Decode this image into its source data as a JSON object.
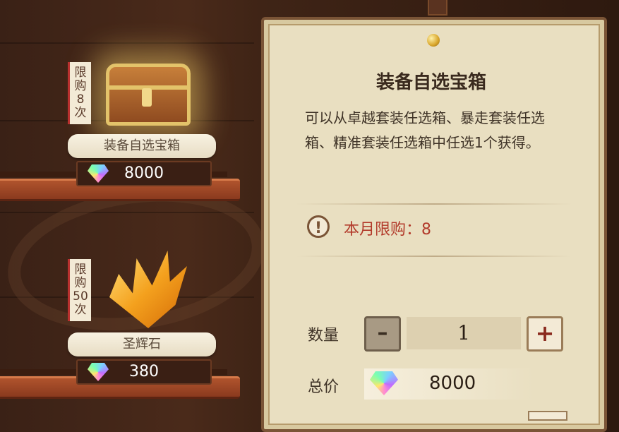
{
  "shop": {
    "items": [
      {
        "limit_chars": [
          "限",
          "购",
          "8",
          "次"
        ],
        "name": "装备自选宝箱",
        "price": "8000",
        "icon": "treasure-chest-icon",
        "currency_icon": "diamond-gem-icon"
      },
      {
        "limit_chars": [
          "限",
          "购",
          "50",
          "次"
        ],
        "name": "圣辉石",
        "price": "380",
        "icon": "orange-crystal-icon",
        "currency_icon": "diamond-gem-icon"
      }
    ]
  },
  "detail": {
    "title": "装备自选宝箱",
    "description": "可以从卓越套装任选箱、暴走套装任选箱、精准套装任选箱中任选1个获得。",
    "monthly_limit": "本月限购：8",
    "quantity_label": "数量",
    "minus_label": "–",
    "quantity": "1",
    "plus_label": "+",
    "total_label": "总价",
    "total_price": "8000",
    "warning_icon": "exclamation-icon",
    "warning_glyph": "!"
  },
  "colors": {
    "limit_text": "#b23a2a",
    "panel_bg": "#e9dfc1"
  }
}
